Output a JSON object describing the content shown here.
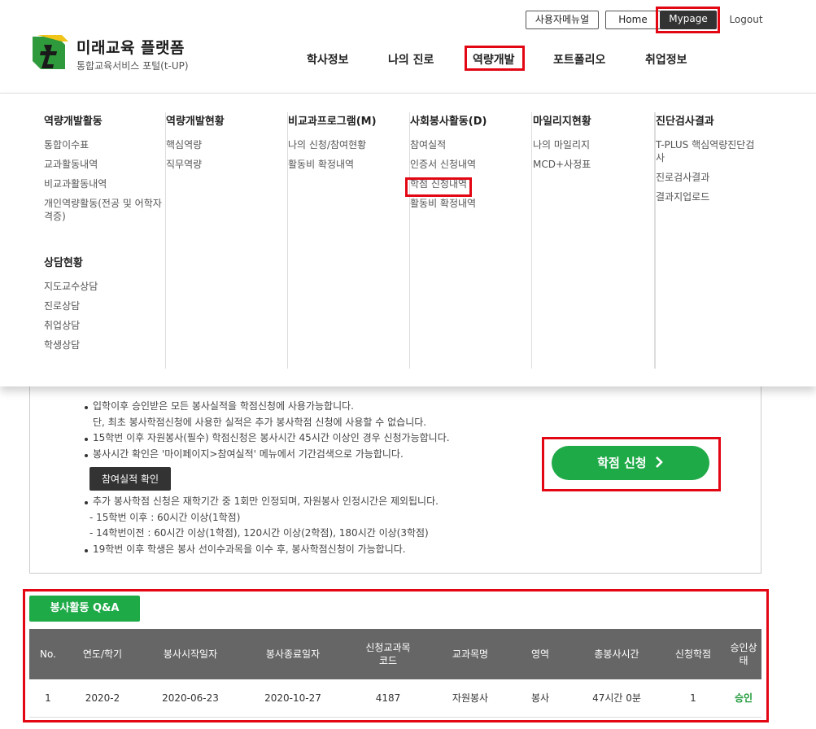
{
  "topbar": {
    "manual": "사용자메뉴얼",
    "home": "Home",
    "mypage": "Mypage",
    "logout": "Logout"
  },
  "logo": {
    "title": "미래교육 플랫폼",
    "subtitle": "통합교육서비스 포털(t-UP)"
  },
  "gnb": [
    "학사정보",
    "나의 진로",
    "역량개발",
    "포트폴리오",
    "취업정보"
  ],
  "mega": {
    "col1": {
      "heading": "역량개발활동",
      "items": [
        "통합이수표",
        "교과활동내역",
        "비교과활동내역",
        "개인역량활동(전공 및 어학자격증)"
      ],
      "heading2": "상담현황",
      "items2": [
        "지도교수상담",
        "진로상담",
        "취업상담",
        "학생상담"
      ]
    },
    "col2": {
      "heading": "역량개발현황",
      "items": [
        "핵심역량",
        "직무역량"
      ]
    },
    "col3": {
      "heading": "비교과프로그램(M)",
      "items": [
        "나의 신청/참여현황",
        "활동비 확정내역"
      ]
    },
    "col4": {
      "heading": "사회봉사활동(D)",
      "items": [
        "참여실적",
        "인증서 신청내역",
        "학점 신청내역",
        "활동비 확정내역"
      ]
    },
    "col5": {
      "heading": "마일리지현황",
      "items": [
        "나의 마일리지",
        "MCD+사정표"
      ]
    },
    "col6": {
      "heading": "진단검사결과",
      "items": [
        "T-PLUS 핵심역량진단검사",
        "진로검사결과",
        "결과지업로드"
      ]
    }
  },
  "notes": {
    "n1": "입학이후 승인받은 모든 봉사실적을 학점신청에 사용가능합니다.",
    "n1b": "단, 최초 봉사학점신청에 사용한 실적은 추가 봉사학점 신청에 사용할 수 없습니다.",
    "n2": "15학번 이후 자원봉사(필수) 학점신청은 봉사시간 45시간 이상인 경우 신청가능합니다.",
    "n3": "봉사시간 확인은 '마이페이지>참여실적' 메뉴에서 기간검색으로 가능합니다.",
    "check_btn": "참여실적 확인",
    "n4": "추가 봉사학점 신청은 재학기간 중 1회만 인정되며, 자원봉사 인정시간은 제외됩니다.",
    "n4a": "- 15학번 이후 : 60시간 이상(1학점)",
    "n4b": "- 14학번이전 : 60시간 이상(1학점), 120시간 이상(2학점), 180시간 이상(3학점)",
    "n5": "19학번 이후 학생은 봉사 선이수과목을 이수 후, 봉사학점신청이 가능합니다."
  },
  "apply_button": "학점 신청",
  "qa_button": "봉사활동 Q&A",
  "table": {
    "headers": [
      "No.",
      "연도/학기",
      "봉사시작일자",
      "봉사종료일자",
      "신청교과목\n코드",
      "교과목명",
      "영역",
      "총봉사시간",
      "신청학점",
      "승인상태"
    ],
    "rows": [
      [
        "1",
        "2020-2",
        "2020-06-23",
        "2020-10-27",
        "4187",
        "자원봉사",
        "봉사",
        "47시간 0분",
        "1",
        "승인"
      ]
    ]
  },
  "colors": {
    "brand_green": "#1faa48",
    "highlight_red": "#e30613",
    "header_gray": "#666666"
  },
  "icons": {
    "logo": "t-logo-icon",
    "apply_arrow": "chevron-right-icon"
  }
}
